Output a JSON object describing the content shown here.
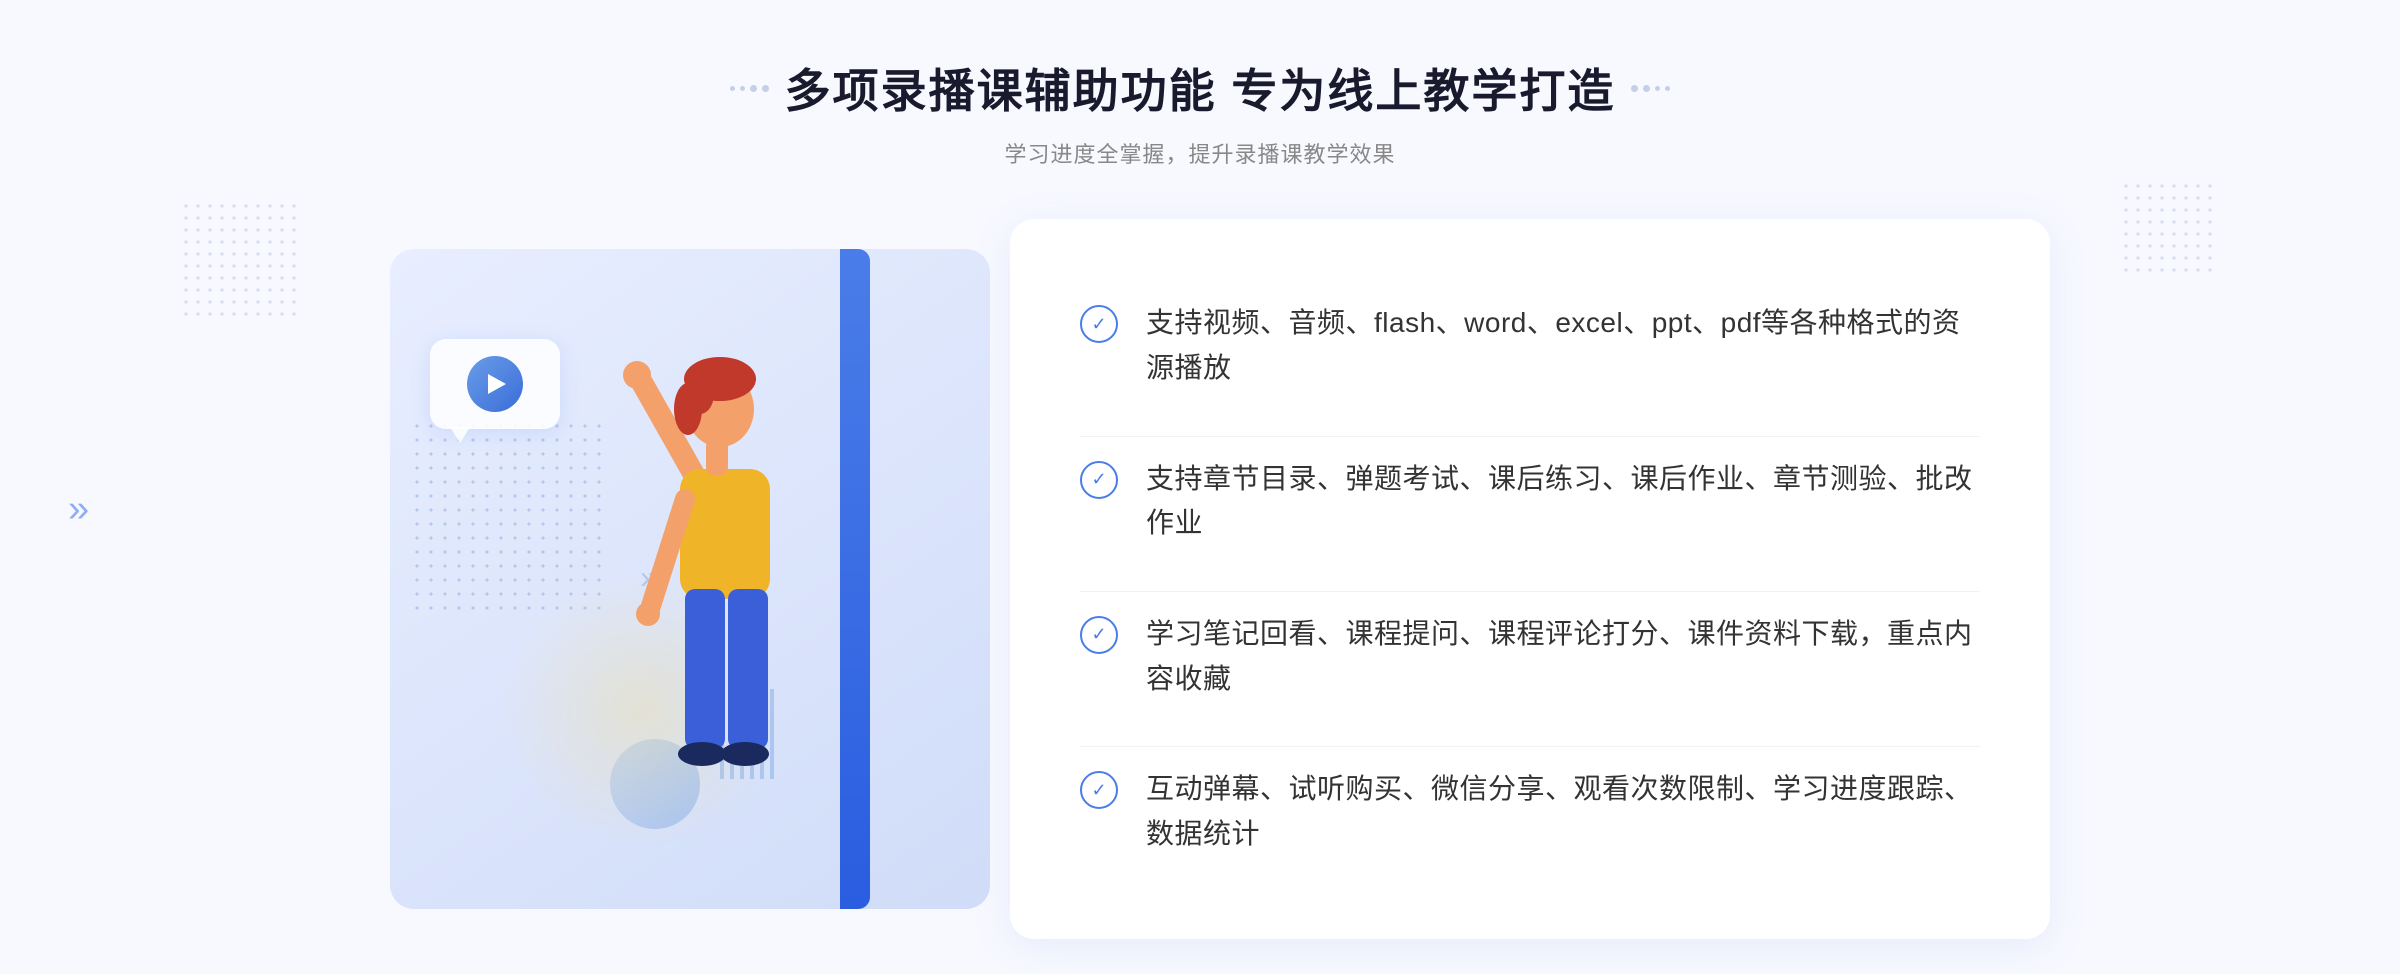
{
  "header": {
    "title": "多项录播课辅助功能 专为线上教学打造",
    "subtitle": "学习进度全掌握，提升录播课教学效果",
    "dots_left": "decorative-dots",
    "dots_right": "decorative-dots"
  },
  "features": [
    {
      "id": "feature-1",
      "text": "支持视频、音频、flash、word、excel、ppt、pdf等各种格式的资源播放"
    },
    {
      "id": "feature-2",
      "text": "支持章节目录、弹题考试、课后练习、课后作业、章节测验、批改作业"
    },
    {
      "id": "feature-3",
      "text": "学习笔记回看、课程提问、课程评论打分、课件资料下载，重点内容收藏"
    },
    {
      "id": "feature-4",
      "text": "互动弹幕、试听购买、微信分享、观看次数限制、学习进度跟踪、数据统计"
    }
  ],
  "colors": {
    "primary_blue": "#4a7de8",
    "light_blue": "#e8eeff",
    "text_dark": "#1a1a2e",
    "text_gray": "#888888",
    "text_body": "#333333",
    "white": "#ffffff",
    "border": "#f0f2f8"
  },
  "decorations": {
    "chevron_symbol": "»",
    "check_symbol": "✓"
  }
}
